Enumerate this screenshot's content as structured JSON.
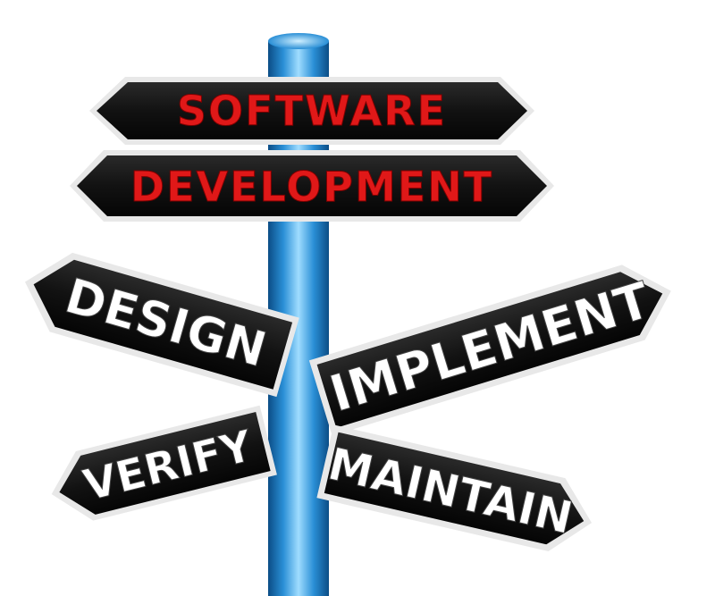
{
  "signpost": {
    "signs": [
      {
        "id": "software",
        "label": "SOFTWARE",
        "text_color": "#e01818"
      },
      {
        "id": "development",
        "label": "DEVELOPMENT",
        "text_color": "#e01818"
      },
      {
        "id": "design",
        "label": "DESIGN",
        "text_color": "#ffffff"
      },
      {
        "id": "implement",
        "label": "IMPLEMENT",
        "text_color": "#ffffff"
      },
      {
        "id": "verify",
        "label": "VERIFY",
        "text_color": "#ffffff"
      },
      {
        "id": "maintain",
        "label": "MAINTAIN",
        "text_color": "#ffffff"
      }
    ],
    "colors": {
      "background": "#ffffff",
      "sign_face": "#151515",
      "sign_border": "#e8e8e8",
      "pole": "#2a8fd6",
      "pole_highlight": "#9fdcff",
      "pole_shadow": "#0b4d86"
    }
  }
}
